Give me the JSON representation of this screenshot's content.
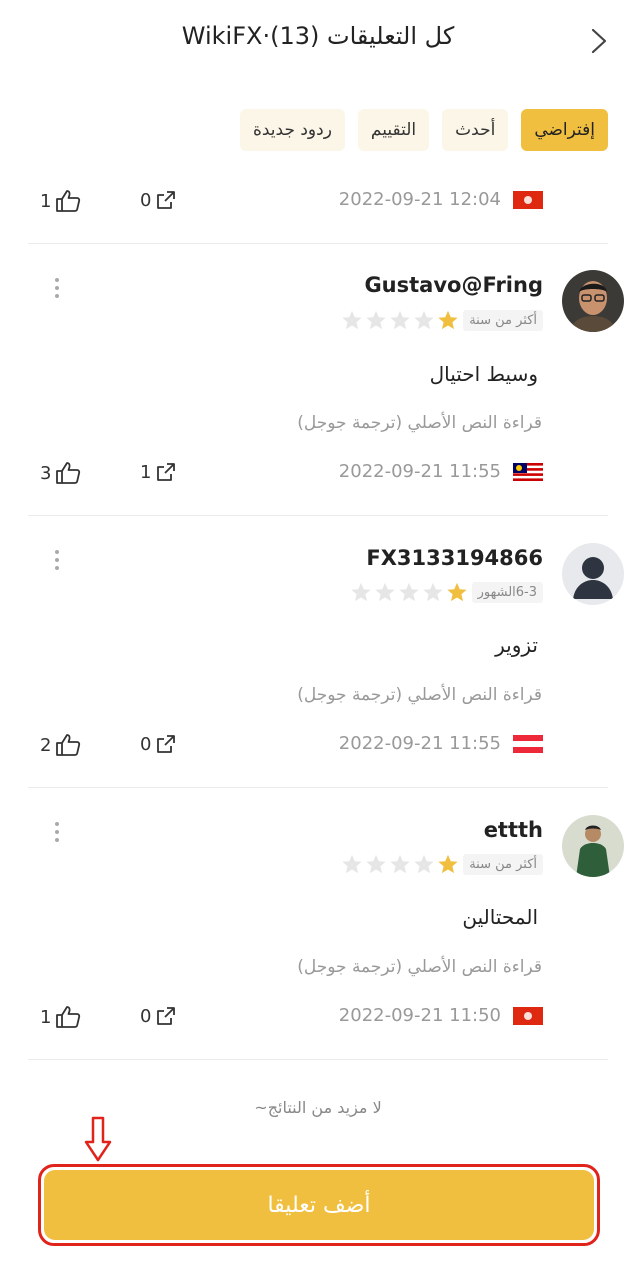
{
  "header": {
    "title": "كل التعليقات (13)·WikiFX"
  },
  "tabs": [
    {
      "label": "إفتراضي",
      "active": true
    },
    {
      "label": "أحدث",
      "active": false
    },
    {
      "label": "التقييم",
      "active": false
    },
    {
      "label": "ردود جديدة",
      "active": false
    }
  ],
  "first_meta": {
    "date": "2022-09-21 12:04",
    "flag": "hong-kong-flag",
    "shares": "0",
    "likes": "1"
  },
  "reviews": [
    {
      "username": "Gustavo@Fring",
      "time_badge": "أكثر من سنة",
      "stars_filled": 1,
      "text": "وسيط احتيال",
      "translate": "قراءة النص الأصلي (ترجمة جوجل)",
      "date": "2022-09-21 11:55",
      "flag": "malaysia-flag",
      "shares": "1",
      "likes": "3"
    },
    {
      "username": "FX3133194866",
      "time_badge": "6-3الشهور",
      "stars_filled": 1,
      "text": "تزوير",
      "translate": "قراءة النص الأصلي (ترجمة جوجل)",
      "date": "2022-09-21 11:55",
      "flag": "austria-flag",
      "shares": "0",
      "likes": "2"
    },
    {
      "username": "ettth",
      "time_badge": "أكثر من سنة",
      "stars_filled": 1,
      "text": "المحتالين",
      "translate": "قراءة النص الأصلي (ترجمة جوجل)",
      "date": "2022-09-21 11:50",
      "flag": "hong-kong-flag",
      "shares": "0",
      "likes": "1"
    }
  ],
  "footer": {
    "no_more": "لا مزيد من النتائج~",
    "add_button": "أضف تعليقا"
  },
  "colors": {
    "accent": "#f1bf3f",
    "tab_bg": "#fbf6e8",
    "annotation_red": "#e0241c"
  }
}
